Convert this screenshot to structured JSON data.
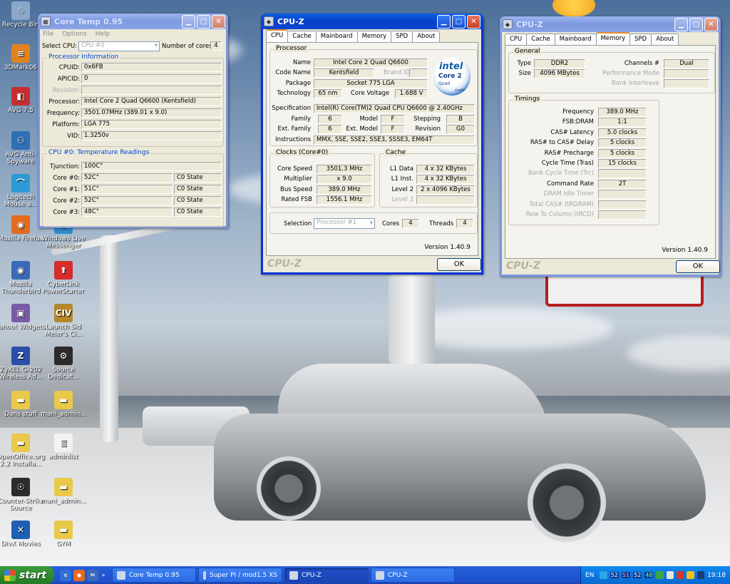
{
  "desktop": {
    "icons": [
      {
        "label": "Recycle Bin",
        "glyph": "♲",
        "color": "#8aa6c8"
      },
      {
        "label": "3DMark06",
        "glyph": "≡",
        "color": "#e0821f"
      },
      {
        "label": "AVG 7.5",
        "glyph": "◧",
        "color": "#c62f2f"
      },
      {
        "label": "AVG Anti-Spyware",
        "glyph": "⚇",
        "color": "#2e6fb5"
      },
      {
        "label": "Logitech Mouse a...",
        "glyph": "⌒",
        "color": "#2d9ad6"
      },
      {
        "label": "Mozilla Firefox",
        "glyph": "◉",
        "color": "#e46a1e"
      },
      {
        "label": "Mozilla Thunderbird",
        "glyph": "◉",
        "color": "#3b69b8"
      },
      {
        "label": "Yahoo! Widgets",
        "glyph": "▣",
        "color": "#7a5aa8"
      },
      {
        "label": "ZyXEL G-202 Wireless Ad...",
        "glyph": "Z",
        "color": "#2b4fa9"
      },
      {
        "label": "Dans stuff",
        "glyph": "▬",
        "color": "#e8c94a"
      },
      {
        "label": "OpenOffice.org 2.2 Installa...",
        "glyph": "▬",
        "color": "#e8c94a"
      },
      {
        "label": "Counter-Strike Source",
        "glyph": "☉",
        "color": "#2c2c2c"
      },
      {
        "label": "DivX Movies",
        "glyph": "✕",
        "color": "#1f5fb4"
      },
      {
        "label": "Windows Live Messenger",
        "glyph": "☺",
        "color": "#2f8ccc"
      },
      {
        "label": "CyberLink PowerStarter",
        "glyph": "⬆",
        "color": "#d52c2c"
      },
      {
        "label": "Launch Sid Meier's Ci...",
        "glyph": "CIV",
        "color": "#b6862a"
      },
      {
        "label": "Source Dedicat...",
        "glyph": "⚙",
        "color": "#2b2b2b"
      },
      {
        "label": "mani_admin...",
        "glyph": "▬",
        "color": "#e8c94a"
      },
      {
        "label": "adminlist",
        "glyph": "≣",
        "color": "#f2f2f2"
      },
      {
        "label": "mani_admin...",
        "glyph": "▬",
        "color": "#e8c94a"
      },
      {
        "label": "GYM",
        "glyph": "▬",
        "color": "#e8c94a"
      }
    ]
  },
  "coretemp": {
    "title": "Core Temp 0.95",
    "menu": [
      "File",
      "Options",
      "Help"
    ],
    "select_cpu_label": "Select CPU:",
    "select_cpu_value": "CPU #0",
    "num_cores_label": "Number of cores",
    "num_cores_value": "4",
    "proc_info_label": "Processor Information",
    "cpuid_label": "CPUID:",
    "cpuid": "0x6FB",
    "apicid_label": "APICID:",
    "apicid": "0",
    "revision_label": "Revision:",
    "revision": "",
    "processor_label": "Processor:",
    "processor": "Intel Core 2 Quad Q6600 (Kentsfield)",
    "frequency_label": "Frequency:",
    "frequency": "3501.07MHz (389.01 x 9.0)",
    "platform_label": "Platform:",
    "platform": "LGA 775",
    "vid_label": "VID:",
    "vid": "1.3250v",
    "temps_label": "CPU #0: Temperature Readings",
    "tjunction_label": "Tjunction:",
    "tjunction": "100C°",
    "cores": [
      {
        "label": "Core #0:",
        "temp": "52C°",
        "state": "C0 State"
      },
      {
        "label": "Core #1:",
        "temp": "51C°",
        "state": "C0 State"
      },
      {
        "label": "Core #2:",
        "temp": "52C°",
        "state": "C0 State"
      },
      {
        "label": "Core #3:",
        "temp": "48C°",
        "state": "C0 State"
      }
    ]
  },
  "cpuz_cpu": {
    "title": "CPU-Z",
    "tabs": [
      "CPU",
      "Cache",
      "Mainboard",
      "Memory",
      "SPD",
      "About"
    ],
    "processor_label": "Processor",
    "name_label": "Name",
    "name": "Intel Core 2 Quad Q6600",
    "codename_label": "Code Name",
    "codename": "Kentsfield",
    "brandid_label": "Brand ID",
    "package_label": "Package",
    "package": "Socket 775 LGA",
    "technology_label": "Technology",
    "technology": "65 nm",
    "corevoltage_label": "Core Voltage",
    "corevoltage": "1.688 V",
    "spec_label": "Specification",
    "spec": "Intel(R) Core(TM)2 Quad CPU    Q6600  @ 2.40GHz",
    "family_label": "Family",
    "family": "6",
    "model_label": "Model",
    "model": "F",
    "stepping_label": "Stepping",
    "stepping": "B",
    "extfamily_label": "Ext. Family",
    "extfamily": "6",
    "extmodel_label": "Ext. Model",
    "extmodel": "F",
    "revision_label": "Revision",
    "revision": "G0",
    "instructions_label": "Instructions",
    "instructions": "MMX, SSE, SSE2, SSE3, SSSE3, EM64T",
    "clocks_label": "Clocks (Core#0)",
    "corespeed_label": "Core Speed",
    "corespeed": "3501.3 MHz",
    "multiplier_label": "Multiplier",
    "multiplier": "x 9.0",
    "busspeed_label": "Bus Speed",
    "busspeed": "389.0 MHz",
    "ratedfsb_label": "Rated FSB",
    "ratedfsb": "1556.1 MHz",
    "cache_label": "Cache",
    "l1data_label": "L1 Data",
    "l1data": "4 x 32 KBytes",
    "l1inst_label": "L1 Inst.",
    "l1inst": "4 x 32 KBytes",
    "level2_label": "Level 2",
    "level2": "2 x 4096 KBytes",
    "level3_label": "Level 3",
    "selection_label": "Selection",
    "selection": "Processor #1",
    "cores_label": "Cores",
    "cores": "4",
    "threads_label": "Threads",
    "threads": "4",
    "version": "Version 1.40.9",
    "logo": "CPU-Z",
    "ok": "OK",
    "intel": {
      "brand": "intel",
      "line": "Core 2",
      "sub": "Quad",
      "tag": "inside"
    }
  },
  "cpuz_mem": {
    "title": "CPU-Z",
    "tabs": [
      "CPU",
      "Cache",
      "Mainboard",
      "Memory",
      "SPD",
      "About"
    ],
    "general_label": "General",
    "type_label": "Type",
    "type": "DDR2",
    "channels_label": "Channels #",
    "channels": "Dual",
    "size_label": "Size",
    "size": "4096 MBytes",
    "perfmode_label": "Performance Mode",
    "bankinter_label": "Bank Interleave",
    "timings_label": "Timings",
    "frequency_label": "Frequency",
    "frequency": "389.0 MHz",
    "fsbdram_label": "FSB:DRAM",
    "fsbdram": "1:1",
    "cas_label": "CAS# Latency",
    "cas": "5.0 clocks",
    "rcd_label": "RAS# to CAS# Delay",
    "rcd": "5 clocks",
    "rp_label": "RAS# Precharge",
    "rp": "5 clocks",
    "tras_label": "Cycle Time (Tras)",
    "tras": "15 clocks",
    "trc_label": "Bank Cycle Time (Trc)",
    "cr_label": "Command Rate",
    "cr": "2T",
    "idle_label": "DRAM Idle Timer",
    "trdram_label": "Total CAS# (tRDRAM)",
    "trcd_label": "Row To Column (tRCD)",
    "version": "Version 1.40.9",
    "logo": "CPU-Z",
    "ok": "OK"
  },
  "taskbar": {
    "start": "start",
    "tasks": [
      "Core Temp 0.95",
      "Super PI / mod1.5 XS",
      "CPU-Z",
      "CPU-Z"
    ],
    "lang": "EN",
    "temps": [
      "52",
      "51",
      "52",
      "48"
    ],
    "clock": "19:18"
  }
}
